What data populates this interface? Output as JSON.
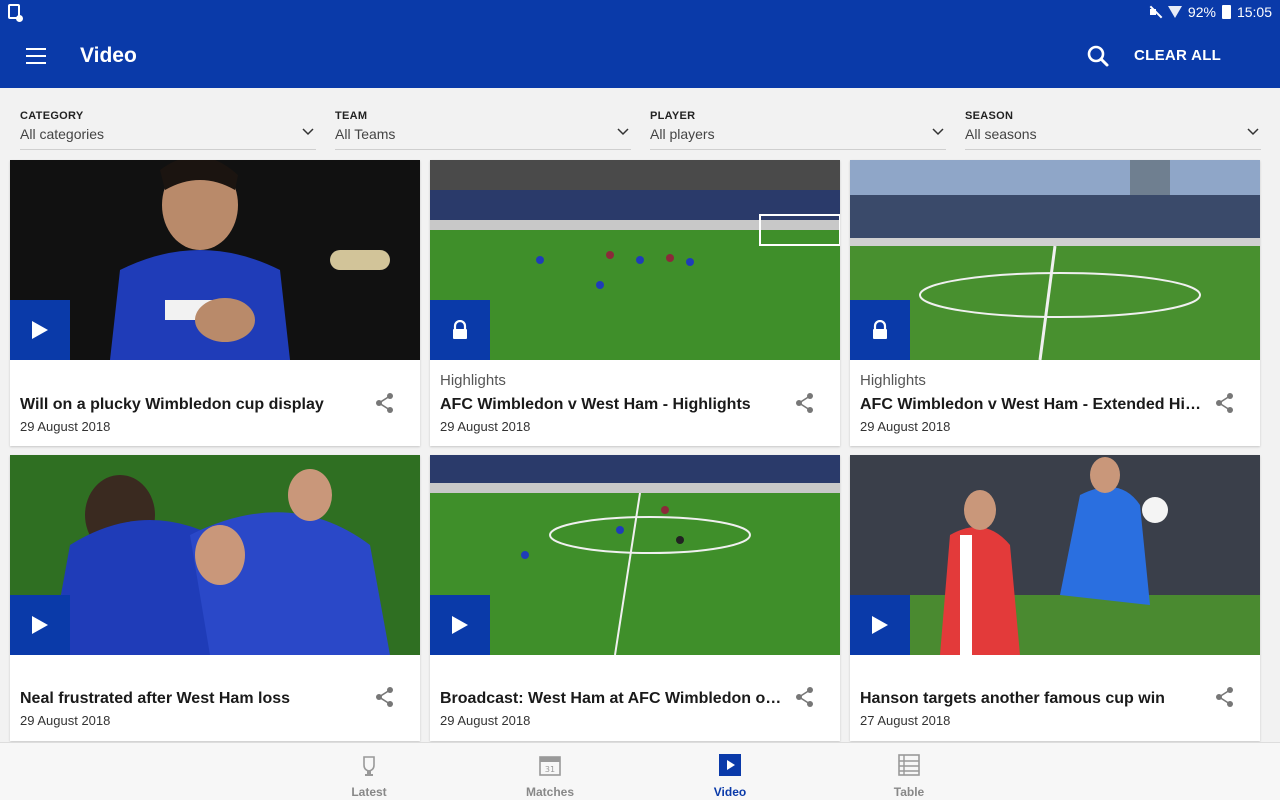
{
  "status_bar": {
    "battery": "92%",
    "time": "15:05"
  },
  "app_bar": {
    "title": "Video",
    "clear_all": "CLEAR ALL"
  },
  "filters": [
    {
      "label": "CATEGORY",
      "value": "All categories"
    },
    {
      "label": "TEAM",
      "value": "All Teams"
    },
    {
      "label": "PLAYER",
      "value": "All players"
    },
    {
      "label": "SEASON",
      "value": "All seasons"
    }
  ],
  "videos": [
    {
      "category": "",
      "title": "Will on a plucky Wimbledon cup display",
      "date": "29 August 2018",
      "access": "play",
      "thumb": "player-portrait"
    },
    {
      "category": "Highlights",
      "title": "AFC Wimbledon v West Ham - Highlights",
      "date": "29 August 2018",
      "access": "locked",
      "thumb": "stadium-pitch"
    },
    {
      "category": "Highlights",
      "title": "AFC Wimbledon v West Ham - Extended Highlights",
      "date": "29 August 2018",
      "access": "locked",
      "thumb": "stadium-pitch"
    },
    {
      "category": "",
      "title": "Neal frustrated after West Ham loss",
      "date": "29 August 2018",
      "access": "play",
      "thumb": "celebration"
    },
    {
      "category": "",
      "title": "Broadcast: West Ham at AFC Wimbledon on...",
      "date": "29 August 2018",
      "access": "play",
      "thumb": "stadium-pitch"
    },
    {
      "category": "",
      "title": "Hanson targets another famous cup win",
      "date": "27 August 2018",
      "access": "play",
      "thumb": "action-tackle"
    }
  ],
  "bottom_nav": [
    {
      "label": "Latest",
      "icon": "trophy-crest-icon",
      "active": false
    },
    {
      "label": "Matches",
      "icon": "calendar-icon",
      "active": false
    },
    {
      "label": "Video",
      "icon": "video-play-icon",
      "active": true
    },
    {
      "label": "Table",
      "icon": "table-list-icon",
      "active": false
    }
  ],
  "colors": {
    "brand": "#0a3aa9",
    "pitch": "#3f8f2a",
    "background": "#f2f2f2"
  }
}
